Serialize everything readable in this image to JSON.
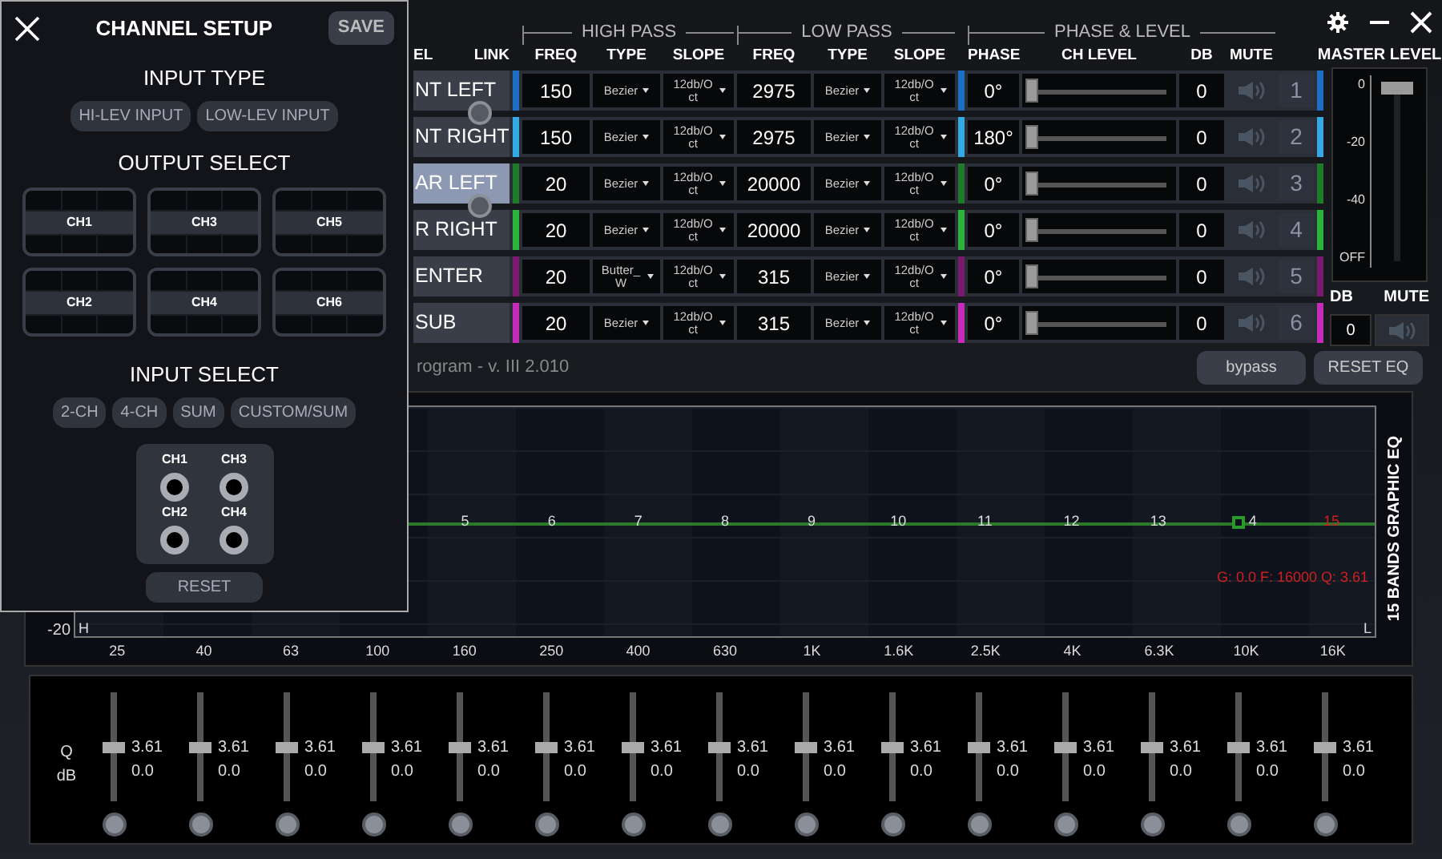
{
  "overlay": {
    "title": "CHANNEL SETUP",
    "save": "SAVE",
    "input_type": {
      "heading": "INPUT TYPE",
      "options": [
        "HI-LEV INPUT",
        "LOW-LEV INPUT"
      ]
    },
    "output_select": {
      "heading": "OUTPUT SELECT",
      "outputs": [
        "CH1",
        "CH3",
        "CH5",
        "CH2",
        "CH4",
        "CH6"
      ]
    },
    "input_select": {
      "heading": "INPUT SELECT",
      "options": [
        "2-CH",
        "4-CH",
        "SUM",
        "CUSTOM/SUM"
      ],
      "jacks": [
        "CH1",
        "CH3",
        "CH2",
        "CH4"
      ]
    },
    "reset": "RESET"
  },
  "header": {
    "groups": [
      "HIGH PASS",
      "LOW PASS",
      "PHASE & LEVEL"
    ],
    "columns": [
      "EL",
      "LINK",
      "FREQ",
      "TYPE",
      "SLOPE",
      "FREQ",
      "TYPE",
      "SLOPE",
      "PHASE",
      "CH LEVEL",
      "DB",
      "MUTE"
    ]
  },
  "links": [
    {
      "linked": true
    },
    {
      "linked": true
    },
    {
      "linked": false
    }
  ],
  "channels": [
    {
      "name": "NT LEFT",
      "selected": false,
      "color": "#1c6fc4",
      "hp_freq": "150",
      "hp_type": "Bezier",
      "hp_slope": "12db/Oct",
      "lp_freq": "2975",
      "lp_type": "Bezier",
      "lp_slope": "12db/Oct",
      "phase": "0°",
      "level": 0,
      "db": "0",
      "muted": false,
      "number": "1"
    },
    {
      "name": "NT RIGHT",
      "selected": false,
      "color": "#35a8e6",
      "hp_freq": "150",
      "hp_type": "Bezier",
      "hp_slope": "12db/Oct",
      "lp_freq": "2975",
      "lp_type": "Bezier",
      "lp_slope": "12db/Oct",
      "phase": "180°",
      "level": 0,
      "db": "0",
      "muted": false,
      "number": "2"
    },
    {
      "name": "AR LEFT",
      "selected": true,
      "color": "#1f7a2a",
      "hp_freq": "20",
      "hp_type": "Bezier",
      "hp_slope": "12db/Oct",
      "lp_freq": "20000",
      "lp_type": "Bezier",
      "lp_slope": "12db/Oct",
      "phase": "0°",
      "level": 0,
      "db": "0",
      "muted": false,
      "number": "3"
    },
    {
      "name": "R RIGHT",
      "selected": false,
      "color": "#2bb33c",
      "hp_freq": "20",
      "hp_type": "Bezier",
      "hp_slope": "12db/Oct",
      "lp_freq": "20000",
      "lp_type": "Bezier",
      "lp_slope": "12db/Oct",
      "phase": "0°",
      "level": 0,
      "db": "0",
      "muted": false,
      "number": "4"
    },
    {
      "name": "ENTER",
      "selected": false,
      "color": "#7a1a6e",
      "hp_freq": "20",
      "hp_type": "Butter_W",
      "hp_slope": "12db/Oct",
      "lp_freq": "315",
      "lp_type": "Bezier",
      "lp_slope": "12db/Oct",
      "phase": "0°",
      "level": 0,
      "db": "0",
      "muted": false,
      "number": "5"
    },
    {
      "name": "SUB",
      "selected": false,
      "color": "#c42bb8",
      "hp_freq": "20",
      "hp_type": "Bezier",
      "hp_slope": "12db/Oct",
      "lp_freq": "315",
      "lp_type": "Bezier",
      "lp_slope": "12db/Oct",
      "phase": "0°",
      "level": 0,
      "db": "0",
      "muted": false,
      "number": "6"
    }
  ],
  "master": {
    "heading": "MASTER LEVEL",
    "scale": [
      "0",
      "-20",
      "-40",
      "OFF"
    ],
    "level": 1,
    "db_label": "DB",
    "mute_label": "MUTE",
    "db": "0",
    "muted": false
  },
  "program": "rogram - v. III 2.010",
  "buttons": [
    "bypass",
    "RESET EQ"
  ],
  "eq_graph": {
    "title": "15 BANDS GRAPHIC EQ",
    "y_label": "-20",
    "low_end_mark": "H",
    "high_end_mark": "L",
    "bands": [
      {
        "label": "5",
        "selected": false,
        "handle": false
      },
      {
        "label": "6",
        "selected": false,
        "handle": false
      },
      {
        "label": "7",
        "selected": false,
        "handle": false
      },
      {
        "label": "8",
        "selected": false,
        "handle": false
      },
      {
        "label": "9",
        "selected": false,
        "handle": false
      },
      {
        "label": "10",
        "selected": false,
        "handle": false
      },
      {
        "label": "11",
        "selected": false,
        "handle": false
      },
      {
        "label": "12",
        "selected": false,
        "handle": false
      },
      {
        "label": "13",
        "selected": false,
        "handle": false
      },
      {
        "label": "4",
        "selected": false,
        "handle": true
      },
      {
        "label": "15",
        "selected": true,
        "handle": false
      }
    ],
    "x_labels": [
      "25",
      "40",
      "63",
      "100",
      "160",
      "250",
      "400",
      "630",
      "1K",
      "1.6K",
      "2.5K",
      "4K",
      "6.3K",
      "10K",
      "16K"
    ],
    "readout": "G: 0.0 F: 16000 Q: 3.61"
  },
  "eq_sliders": {
    "q_label": "Q",
    "db_label": "dB",
    "bands": [
      {
        "level": 0.5,
        "q": "3.61",
        "db": "0.0"
      },
      {
        "level": 0.5,
        "q": "3.61",
        "db": "0.0"
      },
      {
        "level": 0.5,
        "q": "3.61",
        "db": "0.0"
      },
      {
        "level": 0.5,
        "q": "3.61",
        "db": "0.0"
      },
      {
        "level": 0.5,
        "q": "3.61",
        "db": "0.0"
      },
      {
        "level": 0.5,
        "q": "3.61",
        "db": "0.0"
      },
      {
        "level": 0.5,
        "q": "3.61",
        "db": "0.0"
      },
      {
        "level": 0.5,
        "q": "3.61",
        "db": "0.0"
      },
      {
        "level": 0.5,
        "q": "3.61",
        "db": "0.0"
      },
      {
        "level": 0.5,
        "q": "3.61",
        "db": "0.0"
      },
      {
        "level": 0.5,
        "q": "3.61",
        "db": "0.0"
      },
      {
        "level": 0.5,
        "q": "3.61",
        "db": "0.0"
      },
      {
        "level": 0.5,
        "q": "3.61",
        "db": "0.0"
      },
      {
        "level": 0.5,
        "q": "3.61",
        "db": "0.0"
      },
      {
        "level": 0.5,
        "q": "3.61",
        "db": "0.0"
      }
    ]
  }
}
